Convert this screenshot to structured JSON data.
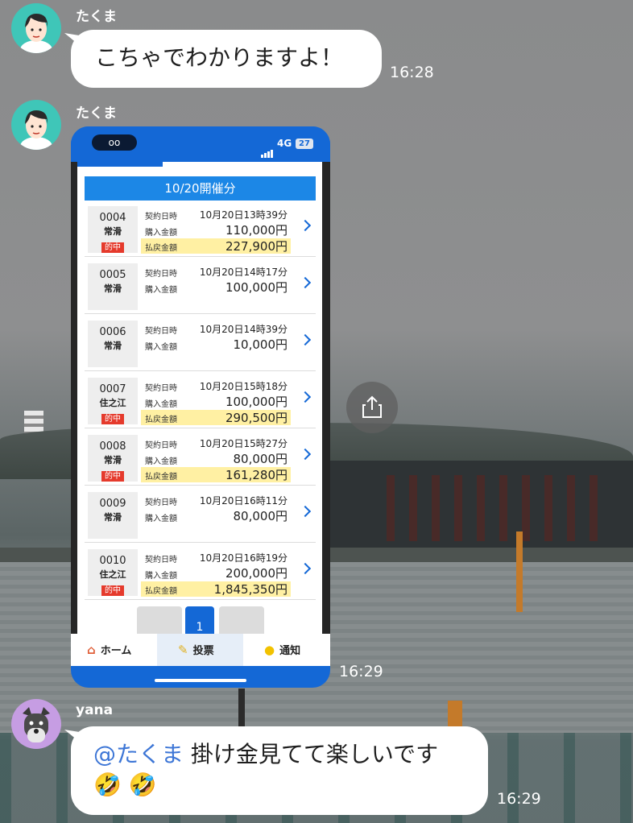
{
  "messages": [
    {
      "sender": "たくま",
      "text": "こちゃでわかりますよ！",
      "time": "16:28"
    },
    {
      "sender": "たくま",
      "time": "16:29"
    },
    {
      "sender": "yana",
      "mention": "@たくま",
      "text": "掛け金見てて楽しいです",
      "emoji": "🤣 🤣",
      "time": "16:29"
    }
  ],
  "screenshot": {
    "status": {
      "voicemail": "oo",
      "network": "4G",
      "battery": "27"
    },
    "date_header": "10/20開催分",
    "labels": {
      "contract": "契約日時",
      "purchase": "購入金額",
      "payout": "払戻金額",
      "hit": "的中"
    },
    "rows": [
      {
        "id": "0004",
        "venue": "常滑",
        "hit": true,
        "datetime": "10月20日13時39分",
        "purchase": "110,000円",
        "payout": "227,900円"
      },
      {
        "id": "0005",
        "venue": "常滑",
        "hit": false,
        "datetime": "10月20日14時17分",
        "purchase": "100,000円"
      },
      {
        "id": "0006",
        "venue": "常滑",
        "hit": false,
        "datetime": "10月20日14時39分",
        "purchase": "10,000円"
      },
      {
        "id": "0007",
        "venue": "住之江",
        "hit": true,
        "datetime": "10月20日15時18分",
        "purchase": "100,000円",
        "payout": "290,500円"
      },
      {
        "id": "0008",
        "venue": "常滑",
        "hit": true,
        "datetime": "10月20日15時27分",
        "purchase": "80,000円",
        "payout": "161,280円"
      },
      {
        "id": "0009",
        "venue": "常滑",
        "hit": false,
        "datetime": "10月20日16時11分",
        "purchase": "80,000円"
      },
      {
        "id": "0010",
        "venue": "住之江",
        "hit": true,
        "datetime": "10月20日16時19分",
        "purchase": "200,000円",
        "payout": "1,845,350円"
      }
    ],
    "pager": {
      "current": "1"
    },
    "nav": {
      "home": "ホーム",
      "vote": "投票",
      "notify": "通知"
    }
  }
}
